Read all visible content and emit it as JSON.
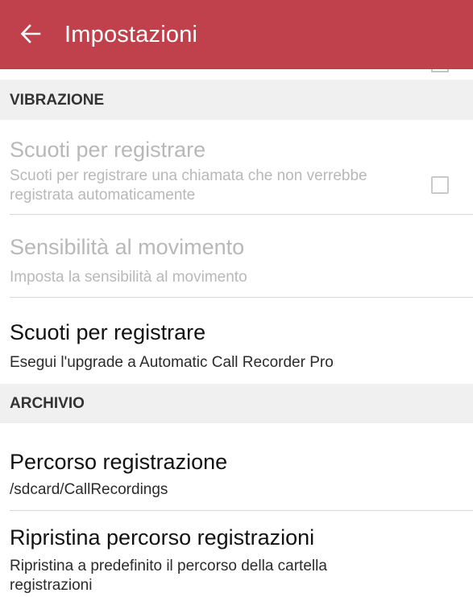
{
  "header": {
    "back_icon": "arrow-left-icon",
    "title": "Impostazioni"
  },
  "sections": {
    "vibrazione": {
      "label": "VIBRAZIONE",
      "items": [
        {
          "title": "Scuoti per registrare",
          "summary": "Scuoti per registrare una chiamata che non verrebbe registrata automaticamente",
          "enabled": false,
          "checked": false
        },
        {
          "title": "Sensibilità al movimento",
          "summary": "Imposta la sensibilità al movimento",
          "enabled": false
        },
        {
          "title": "Scuoti per registrare",
          "summary": "Esegui l'upgrade a Automatic Call Recorder Pro",
          "enabled": true
        }
      ]
    },
    "archivio": {
      "label": "ARCHIVIO",
      "items": [
        {
          "title": "Percorso registrazione",
          "summary": "/sdcard/CallRecordings",
          "enabled": true
        },
        {
          "title": "Ripristina percorso registrazioni",
          "summary": "Ripristina a predefinito il percorso della cartella registrazioni",
          "enabled": true
        }
      ]
    }
  },
  "colors": {
    "toolbar": "#c0414b",
    "section_header_bg": "#f0f0f0",
    "disabled_text": "#b8b8b8"
  }
}
